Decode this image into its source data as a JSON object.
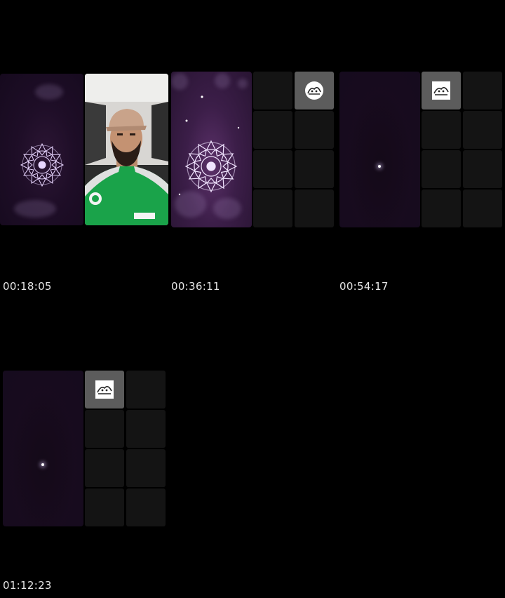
{
  "timestamps": [
    "00:18:05",
    "00:36:11",
    "00:54:17",
    "01:12:23"
  ],
  "icons": {
    "mandala": "mandala-icon",
    "logo": "app-logo-icon",
    "person": "person-video-feed"
  },
  "colors": {
    "background": "#000000",
    "tile": "#141414",
    "logo_tile": "#5c5c5c",
    "mandala_stroke": "#e8d6ff",
    "jersey": "#1aa34a"
  }
}
